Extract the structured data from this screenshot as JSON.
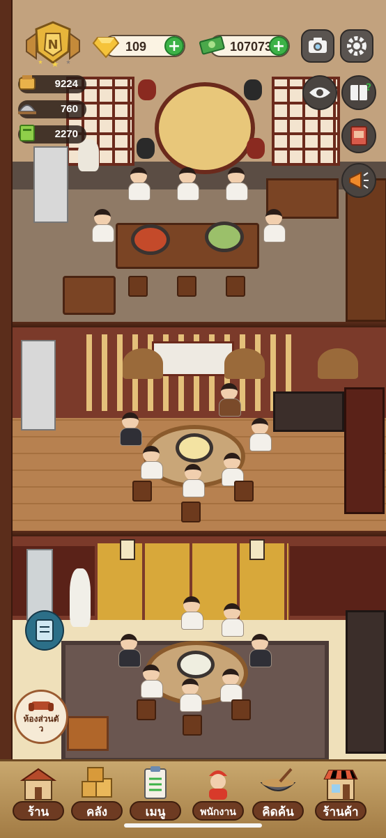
{
  "hud": {
    "gems": "109",
    "cash": "107073",
    "stats": [
      {
        "icon": "ingredient-icon",
        "value": "9224"
      },
      {
        "icon": "dish-cover-icon",
        "value": "760"
      },
      {
        "icon": "coupon-icon",
        "value": "2270"
      }
    ],
    "plus_symbol": "+"
  },
  "side": {
    "room_button_label": "ห้องส่วนตั\nว"
  },
  "nav": {
    "items": [
      {
        "id": "shop",
        "label": "ร้าน",
        "icon": "shop-icon"
      },
      {
        "id": "storage",
        "label": "คลัง",
        "icon": "boxes-icon"
      },
      {
        "id": "menu",
        "label": "เมนู",
        "icon": "clipboard-icon"
      },
      {
        "id": "staff",
        "label": "พนักงาน",
        "icon": "waiter-icon"
      },
      {
        "id": "recipe",
        "label": "คิดค้น",
        "icon": "wok-icon"
      },
      {
        "id": "store",
        "label": "ร้านค้า",
        "icon": "store-icon"
      }
    ]
  },
  "colors": {
    "accent_green": "#3cb247",
    "nav_label_bg": "#6e3b22",
    "gold": "#e7b53b"
  }
}
